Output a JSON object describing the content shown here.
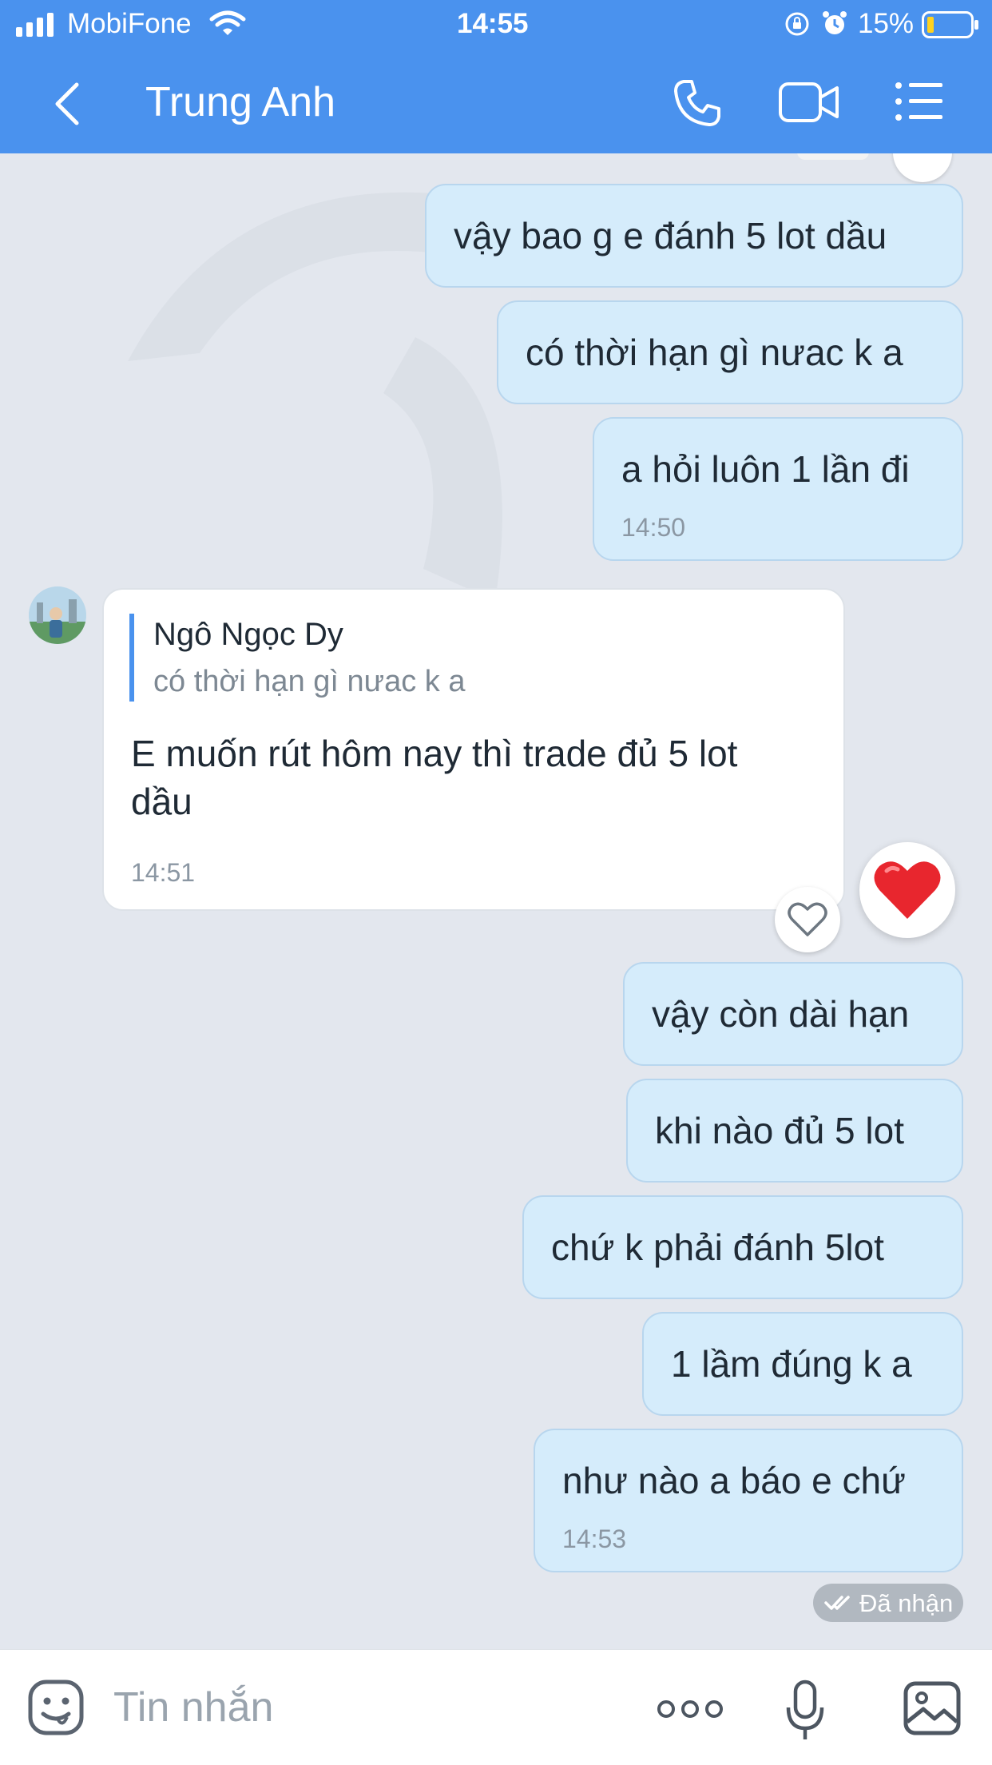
{
  "status_bar": {
    "carrier": "MobiFone",
    "time": "14:55",
    "battery": "15%"
  },
  "header": {
    "back_icon": "chevron-left-icon",
    "contact_name": "Trung Anh",
    "call_icon": "phone-icon",
    "video_icon": "video-camera-icon",
    "menu_icon": "list-menu-icon",
    "color": "#4a92ee"
  },
  "messages": [
    {
      "sender": "me",
      "text": "vậy bao g e đánh 5 lot dầu"
    },
    {
      "sender": "me",
      "text": "có thời hạn gì nưac k a"
    },
    {
      "sender": "me",
      "text": "a hỏi luôn 1 lần đi",
      "time": "14:50"
    },
    {
      "sender": "them",
      "quote_author": "Ngô Ngọc Dy",
      "quote_text": "có thời hạn gì nưac k a",
      "text_line1": "E muốn rút hôm nay thì trade đủ 5 lot",
      "text_line2": "dầu",
      "time": "14:51",
      "reaction_icon": "heart-icon"
    },
    {
      "sender": "me",
      "text": "vậy còn dài hạn"
    },
    {
      "sender": "me",
      "text": "khi nào đủ 5 lot"
    },
    {
      "sender": "me",
      "text": "chứ k phải đánh 5lot"
    },
    {
      "sender": "me",
      "text": "1 lầm đúng k a"
    },
    {
      "sender": "me",
      "text": "như nào a báo e chứ",
      "time": "14:53"
    }
  ],
  "delivery_status": "Đã nhận",
  "composer": {
    "placeholder": "Tin nhắn",
    "sticker_icon": "sticker-face-icon",
    "more_icon": "more-dots-icon",
    "mic_icon": "microphone-icon",
    "image_icon": "image-icon"
  },
  "colors": {
    "my_bubble": "#d5ecfb",
    "their_bubble": "#ffffff",
    "chat_bg": "#e3e7ee",
    "heart": "#e8262e"
  }
}
